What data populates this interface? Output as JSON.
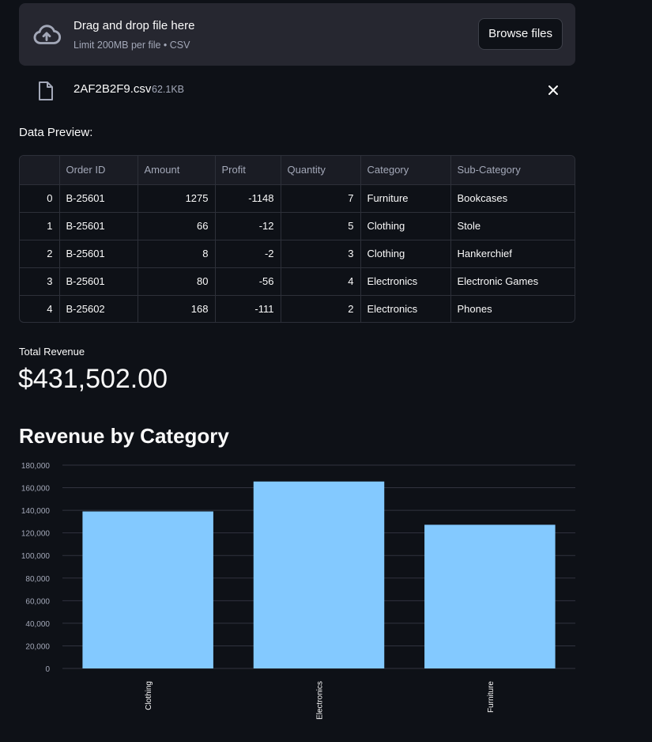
{
  "uploader": {
    "title": "Drag and drop file here",
    "subtitle": "Limit 200MB per file • CSV",
    "browse_label": "Browse files",
    "icon": "cloud-upload-icon"
  },
  "uploaded_file": {
    "name": "2AF2B2F9.csv",
    "size": "62.1KB",
    "icon": "file-icon",
    "remove_icon": "close-icon"
  },
  "preview": {
    "label": "Data Preview:",
    "columns": [
      "",
      "Order ID",
      "Amount",
      "Profit",
      "Quantity",
      "Category",
      "Sub-Category"
    ],
    "rows": [
      [
        "0",
        "B-25601",
        "1275",
        "-1148",
        "7",
        "Furniture",
        "Bookcases"
      ],
      [
        "1",
        "B-25601",
        "66",
        "-12",
        "5",
        "Clothing",
        "Stole"
      ],
      [
        "2",
        "B-25601",
        "8",
        "-2",
        "3",
        "Clothing",
        "Hankerchief"
      ],
      [
        "3",
        "B-25601",
        "80",
        "-56",
        "4",
        "Electronics",
        "Electronic Games"
      ],
      [
        "4",
        "B-25602",
        "168",
        "-111",
        "2",
        "Electronics",
        "Phones"
      ]
    ]
  },
  "metric": {
    "label": "Total Revenue",
    "value": "$431,502.00"
  },
  "chart_section": {
    "title": "Revenue by Category"
  },
  "chart_data": {
    "type": "bar",
    "categories": [
      "Clothing",
      "Electronics",
      "Furniture"
    ],
    "values": [
      139000,
      165500,
      127200
    ],
    "yticks": [
      "180,000",
      "160,000",
      "140,000",
      "120,000",
      "100,000",
      "80,000",
      "60,000",
      "40,000",
      "20,000",
      "0"
    ],
    "ylim": [
      0,
      180000
    ],
    "grid": true,
    "bar_color": "#83c9ff",
    "xlabel": "",
    "ylabel": ""
  },
  "colors": {
    "background": "#0e1117",
    "panel": "#262730",
    "muted_text": "#a3a8b8",
    "bar": "#83c9ff"
  }
}
